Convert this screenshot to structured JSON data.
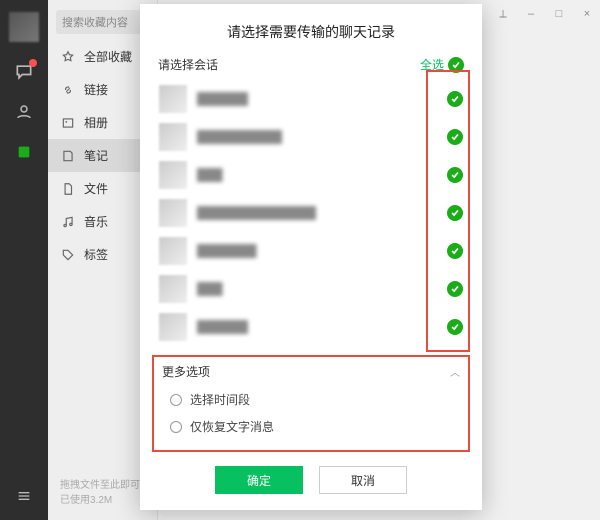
{
  "rail": {
    "icons": [
      "chat",
      "contacts",
      "favorites"
    ],
    "badge": "1"
  },
  "sidebar": {
    "search_placeholder": "搜索收藏内容",
    "items": [
      {
        "icon": "star",
        "label": "全部收藏"
      },
      {
        "icon": "link",
        "label": "链接"
      },
      {
        "icon": "image",
        "label": "相册"
      },
      {
        "icon": "note",
        "label": "笔记"
      },
      {
        "icon": "file",
        "label": "文件"
      },
      {
        "icon": "music",
        "label": "音乐"
      },
      {
        "icon": "tag",
        "label": "标签"
      }
    ],
    "active_index": 3,
    "storage_line1": "拖拽文件至此即可",
    "storage_line2": "已使用3.2M"
  },
  "window": {
    "pin": "⟂",
    "min": "–",
    "max": "□",
    "close": "×"
  },
  "modal": {
    "title": "请选择需要传输的聊天记录",
    "select_session_label": "请选择会话",
    "select_all_label": "全选",
    "conversations": [
      {
        "name": "██████"
      },
      {
        "name": "██████████"
      },
      {
        "name": "███"
      },
      {
        "name": "██████████████"
      },
      {
        "name": "███████"
      },
      {
        "name": "███"
      },
      {
        "name": "██████"
      }
    ],
    "more_options_label": "更多选项",
    "option_time_range": "选择时间段",
    "option_text_only": "仅恢复文字消息",
    "ok_label": "确定",
    "cancel_label": "取消"
  },
  "colors": {
    "accent": "#07c160",
    "danger_outline": "#e74c3c"
  }
}
